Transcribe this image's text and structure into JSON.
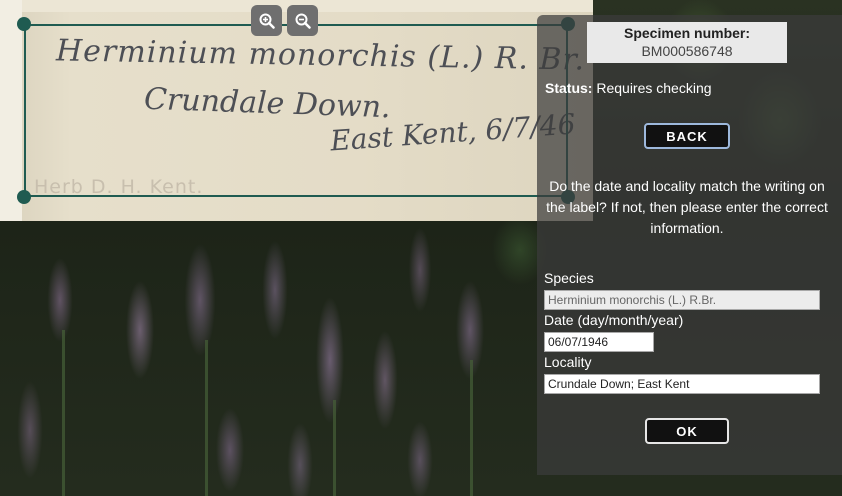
{
  "label_image": {
    "handwriting": [
      "Herminium monorchis (L.) R. Br.",
      "Crundale Down.",
      "East Kent, 6/7/46"
    ],
    "stamp": "Herb D. H. Kent."
  },
  "zoom": {
    "in_icon": "zoom-in-icon",
    "out_icon": "zoom-out-icon"
  },
  "specimen": {
    "title": "Specimen number:",
    "number": "BM000586748"
  },
  "status": {
    "label": "Status:",
    "value": "Requires checking"
  },
  "buttons": {
    "back": "BACK",
    "ok": "OK"
  },
  "question": "Do the date and locality match the writing on the label? If not, then please enter the correct information.",
  "form": {
    "species_label": "Species",
    "species_value": "Herminium monorchis (L.) R.Br.",
    "date_label": "Date (day/month/year)",
    "date_value": "06/07/1946",
    "locality_label": "Locality",
    "locality_value": "Crundale Down; East Kent"
  },
  "colors": {
    "frame": "#1f5b51",
    "panel": "#3c3c3c",
    "button": "#111111"
  }
}
